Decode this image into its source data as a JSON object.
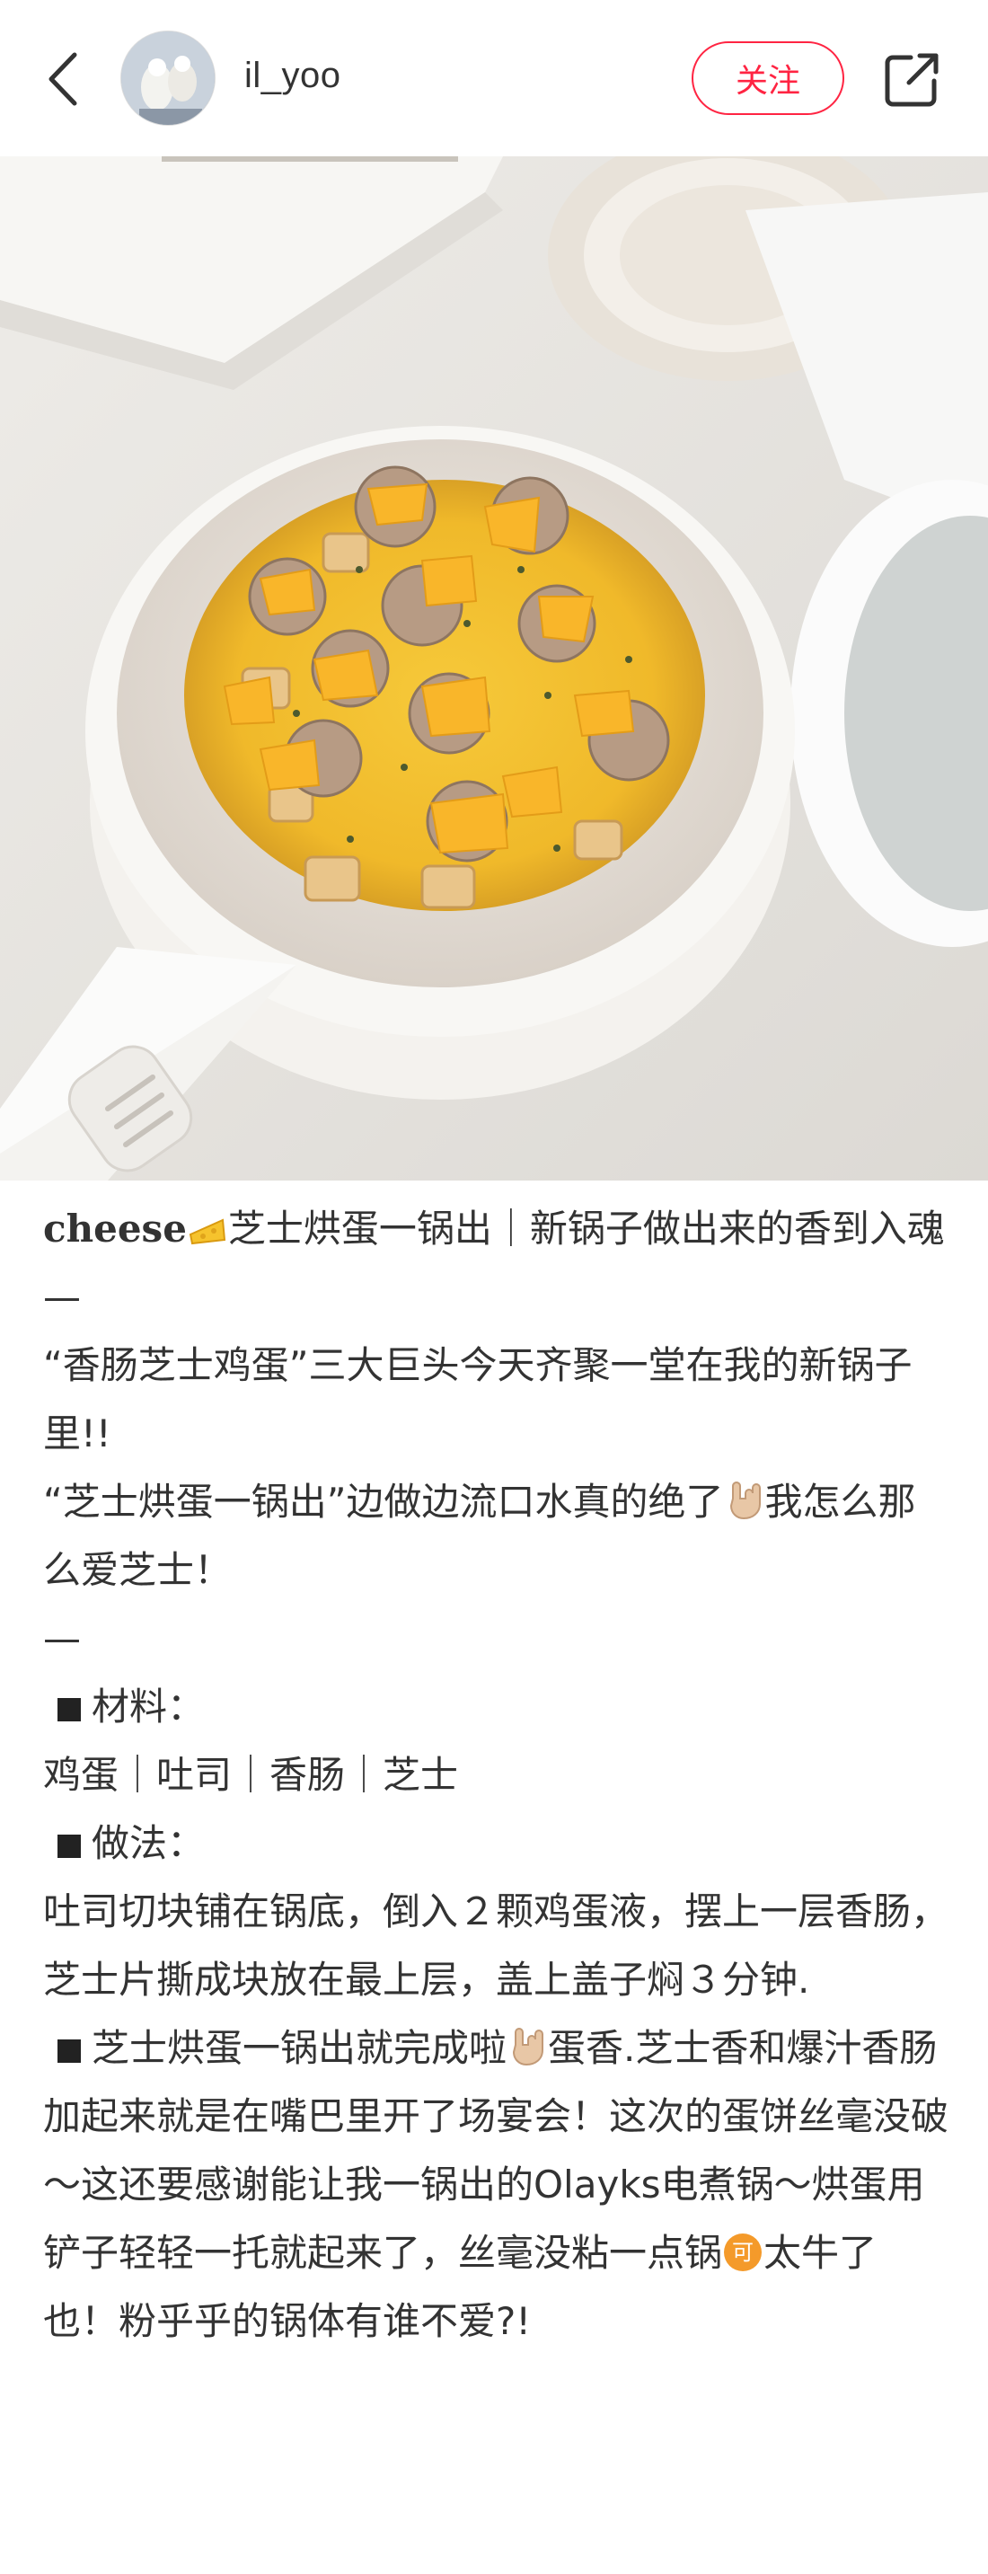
{
  "header": {
    "username": "il_yoo",
    "follow_label": "关注",
    "icons": [
      "chevron-left-icon",
      "avatar",
      "share-icon"
    ]
  },
  "accent_color": "#ff2442",
  "post": {
    "title_en": "cheese",
    "title_rest": "芝士烘蛋一锅出｜新锅子做出来的香到入魂",
    "dash1": "—",
    "line1": "“香肠芝士鸡蛋”三大巨头今天齐聚一堂在我的新锅子里!!",
    "line2a": "“芝士烘蛋一锅出”边做边流口水真的绝了",
    "line2b": "我怎么那么爱芝士！",
    "dash2": "—",
    "ingredients_label": "材料：",
    "ingredients": "鸡蛋｜吐司｜香肠｜芝士",
    "method_label": "做法：",
    "method": "吐司切块铺在锅底，倒入２颗鸡蛋液，摆上一层香肠，芝士片撕成块放在最上层，盖上盖子焖３分钟.",
    "finish_a": "芝士烘蛋一锅出就完成啦",
    "finish_b": "蛋香.芝士香和爆汁香肠加起来就是在嘴巴里开了场宴会！这次的蛋饼丝毫没破～这还要感谢能让我一锅出的Olayks电煮锅～烘蛋用铲子轻轻一托就起来了，丝毫没粘一点锅",
    "finish_c": "太牛了也！粉乎乎的锅体有谁不爱?!",
    "emojis": [
      "cheese-emoji",
      "rock-hand-emoji",
      "rock-hand-emoji",
      "ke-badge-emoji"
    ]
  }
}
